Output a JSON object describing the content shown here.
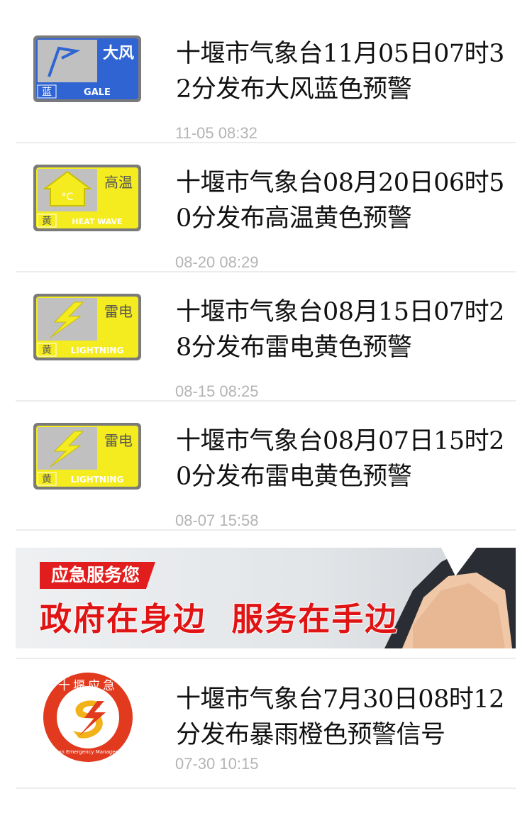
{
  "news": [
    {
      "title": "十堰市气象台11月05日07时32分发布大风蓝色预警",
      "time": "11-05 08:32",
      "icon": "gale-blue-warning-icon",
      "badge_cn": "大风",
      "badge_level": "蓝",
      "badge_en": "GALE",
      "color": "#2f64d2"
    },
    {
      "title": "十堰市气象台08月20日06时50分发布高温黄色预警",
      "time": "08-20 08:29",
      "icon": "heat-wave-yellow-warning-icon",
      "badge_cn": "高温",
      "badge_level": "黄",
      "badge_en": "HEAT WAVE",
      "color": "#f5ec1f"
    },
    {
      "title": "十堰市气象台08月15日07时28分发布雷电黄色预警",
      "time": "08-15 08:25",
      "icon": "lightning-yellow-warning-icon",
      "badge_cn": "雷电",
      "badge_level": "黄",
      "badge_en": "LIGHTNING",
      "color": "#f5ec1f"
    },
    {
      "title": "十堰市气象台08月07日15时20分发布雷电黄色预警",
      "time": "08-07 15:58",
      "icon": "lightning-yellow-warning-icon",
      "badge_cn": "雷电",
      "badge_level": "黄",
      "badge_en": "LIGHTNING",
      "color": "#f5ec1f"
    }
  ],
  "banner": {
    "tag": "应急服务您",
    "slogan": "政府在身边  服务在手边"
  },
  "last": {
    "title": "十堰市气象台7月30日08时12分发布暴雨橙色预警信号",
    "time": "07-30 10:15",
    "logo_cn": "十堰应急",
    "logo_en": "Shiyan Emergency Management"
  }
}
